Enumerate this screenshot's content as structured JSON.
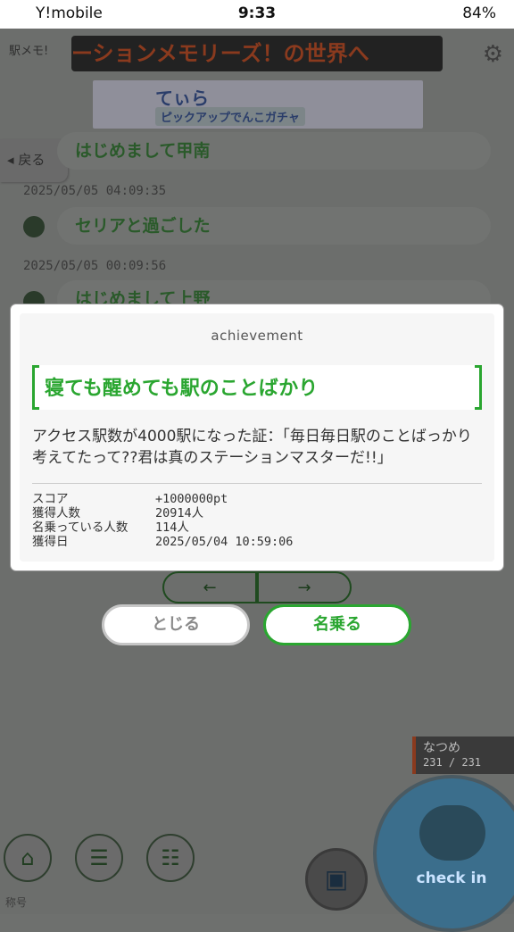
{
  "status_bar": {
    "carrier": "Y!mobile",
    "time": "9:33",
    "battery": "84%"
  },
  "app": {
    "logo_text": "駅メモ!",
    "marquee_text": "ーションメモリーズ！の世界へ",
    "banner": {
      "title": "てぃら",
      "subtitle": "ピックアップでんこガチャ"
    },
    "back_label": "戻る",
    "items": [
      {
        "title": "はじめまして甲南",
        "date": ""
      },
      {
        "title": "セリアと過ごした",
        "date": "2025/05/05 04:09:35"
      },
      {
        "title": "はじめまして上野",
        "date": "2025/05/05 00:09:56"
      }
    ],
    "pager": {
      "prev": "←",
      "next": "→"
    }
  },
  "dialog": {
    "heading": "achievement",
    "title": "寝ても醒めても駅のことばかり",
    "description": "アクセス駅数が4000駅になった証：「毎日毎日駅のことばっかり考えてたって??君は真のステーションマスターだ!!」",
    "stats": [
      {
        "label": "スコア",
        "value": "+1000000pt"
      },
      {
        "label": "獲得人数",
        "value": "20914人"
      },
      {
        "label": "名乗っている人数",
        "value": "114人"
      },
      {
        "label": "獲得日",
        "value": "2025/05/04 10:59:06"
      }
    ]
  },
  "buttons": {
    "close": "とじる",
    "claim": "名乗る"
  },
  "player": {
    "name": "なつめ",
    "score": "231 / 231"
  },
  "checkin_label": "check in",
  "footer_label": "称号",
  "colors": {
    "accent": "#2aa630",
    "overlay": "#6c6e6c"
  }
}
